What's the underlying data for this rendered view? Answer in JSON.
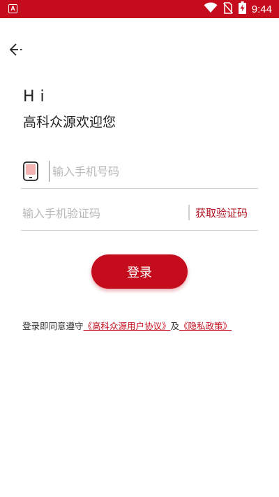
{
  "status_bar": {
    "time": "9:44",
    "app_badge": "A",
    "icons": [
      "wifi-icon",
      "no-sim-icon",
      "battery-charging-icon"
    ],
    "color": "#c40c1c"
  },
  "header": {
    "back_icon": "back-arrow-icon"
  },
  "greeting": {
    "hi": "Hi",
    "welcome": "高科众源欢迎您"
  },
  "phone": {
    "icon": "phone-icon",
    "placeholder": "输入手机号码",
    "value": ""
  },
  "code": {
    "placeholder": "输入手机验证码",
    "value": "",
    "get_code_label": "获取验证码"
  },
  "login": {
    "label": "登录",
    "color": "#c40c1c"
  },
  "agreement": {
    "prefix": "登录即同意遵守",
    "user_agreement": "《高科众源用户协议》",
    "conjunction": "及",
    "privacy_policy": "《隐私政策》",
    "link_color": "#c40c1c"
  }
}
